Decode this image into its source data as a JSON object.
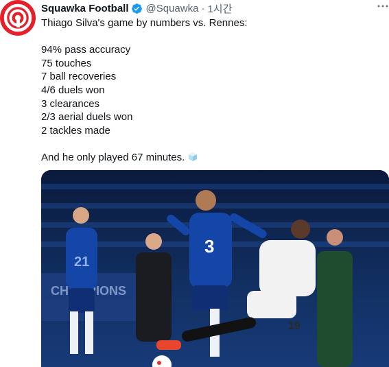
{
  "tweet": {
    "display_name": "Squawka Football",
    "handle": "@Squawka",
    "separator": "·",
    "timestamp": "1시간",
    "more_icon": "more-horizontal-icon",
    "verified_icon": "verified-badge-icon",
    "lines": [
      "Thiago Silva's game by numbers vs. Rennes:",
      "",
      "94% pass accuracy",
      "75 touches",
      "7 ball recoveries",
      "4/6 duels won",
      "3 clearances",
      "2/3 aerial duels won",
      "2 tackles made",
      "",
      "And he only played 67 minutes."
    ],
    "emoji": "ice-cube-emoji",
    "media": {
      "type": "photo",
      "shirt_numbers": [
        "3",
        "21",
        "19"
      ],
      "ad_board_text": "CHAMPIONS"
    }
  },
  "colors": {
    "brand_red": "#e4202b",
    "verified_blue": "#1d9bf0",
    "text_primary": "#0f1419",
    "text_secondary": "#536471"
  }
}
